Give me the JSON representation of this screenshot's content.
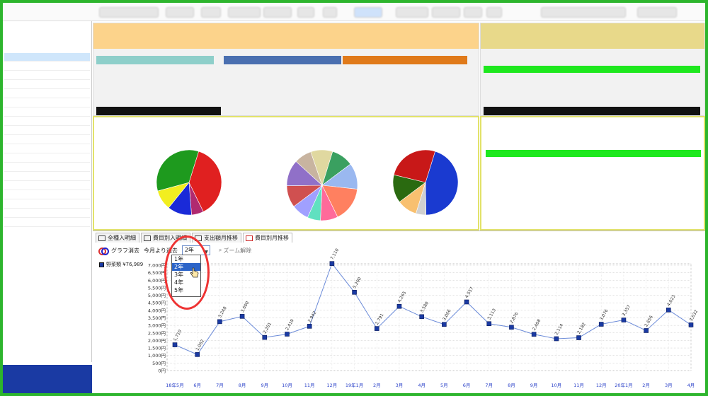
{
  "app": {
    "accent": "#2db52d",
    "frame_color": "#2db52d"
  },
  "bottom_tabs": [
    {
      "label": "全種入明細",
      "icon": "table-icon"
    },
    {
      "label": "費目別入明細",
      "icon": "table-icon"
    },
    {
      "label": "支出額月推移",
      "icon": "grid-icon"
    },
    {
      "label": "費目別月推移",
      "icon": "chart-icon"
    }
  ],
  "controls": {
    "graph_clear_label": "グラフ消去",
    "period_label": "今月より過去",
    "period_selected": "2年",
    "zoom_reset_label": "ズーム解除"
  },
  "period_options": [
    "1年",
    "2年",
    "3年",
    "4年",
    "5年"
  ],
  "legend": {
    "series_label": "野菜類 ¥76,989"
  },
  "chart_data": {
    "type": "line",
    "series": [
      {
        "name": "野菜類 ¥76,989",
        "color": "#2a4fb8",
        "values": [
          1710,
          1062,
          3248,
          3600,
          2201,
          2419,
          2942,
          7110,
          5200,
          2791,
          4265,
          3580,
          3066,
          4557,
          3113,
          2876,
          2408,
          2114,
          2182,
          3076,
          3357,
          2656,
          4023,
          3032
        ]
      }
    ],
    "data_labels": [
      "1,710",
      "1,062",
      "3,248",
      "3,600",
      "2,201",
      "2,419",
      "2,942",
      "7,110",
      "5,200",
      "2,791",
      "4,265",
      "3,580",
      "3,066",
      "4,557",
      "3,113",
      "2,876",
      "2,408",
      "2,114",
      "2,182",
      "3,076",
      "3,357",
      "2,656",
      "4,023",
      "3,032"
    ],
    "categories": [
      "18年5月",
      "6月",
      "7月",
      "8月",
      "9月",
      "10月",
      "11月",
      "12月",
      "19年1月",
      "2月",
      "3月",
      "4月",
      "5月",
      "6月",
      "7月",
      "8月",
      "9月",
      "10月",
      "11月",
      "12月",
      "20年1月",
      "2月",
      "3月",
      "4月"
    ],
    "y_ticks": [
      "0円",
      "500円",
      "1,000円",
      "1,500円",
      "2,000円",
      "2,500円",
      "3,000円",
      "3,500円",
      "4,000円",
      "4,500円",
      "5,000円",
      "5,500円",
      "6,000円",
      "6,500円",
      "7,000円"
    ],
    "ylim": [
      0,
      7000
    ],
    "grid": true
  },
  "pies": [
    {
      "slices": [
        {
          "v": 38,
          "c": "#e02020"
        },
        {
          "v": 6,
          "c": "#b02a70"
        },
        {
          "v": 12,
          "c": "#1a2ad8"
        },
        {
          "v": 10,
          "c": "#f2ee20"
        },
        {
          "v": 34,
          "c": "#1e9a1e"
        }
      ]
    },
    {
      "slices": [
        {
          "v": 10,
          "c": "#3aa060"
        },
        {
          "v": 12,
          "c": "#9ab8f0"
        },
        {
          "v": 16,
          "c": "#ff8060"
        },
        {
          "v": 8,
          "c": "#ff6a9a"
        },
        {
          "v": 6,
          "c": "#60e0c0"
        },
        {
          "v": 8,
          "c": "#a0a0ff"
        },
        {
          "v": 10,
          "c": "#d05050"
        },
        {
          "v": 12,
          "c": "#9070c8"
        },
        {
          "v": 8,
          "c": "#c8b4a0"
        },
        {
          "v": 10,
          "c": "#e0d8a0"
        }
      ]
    },
    {
      "slices": [
        {
          "v": 45,
          "c": "#1a3ad0"
        },
        {
          "v": 5,
          "c": "#d0d0d0"
        },
        {
          "v": 10,
          "c": "#f8c070"
        },
        {
          "v": 14,
          "c": "#2a6a10"
        },
        {
          "v": 26,
          "c": "#c81818"
        }
      ]
    }
  ]
}
